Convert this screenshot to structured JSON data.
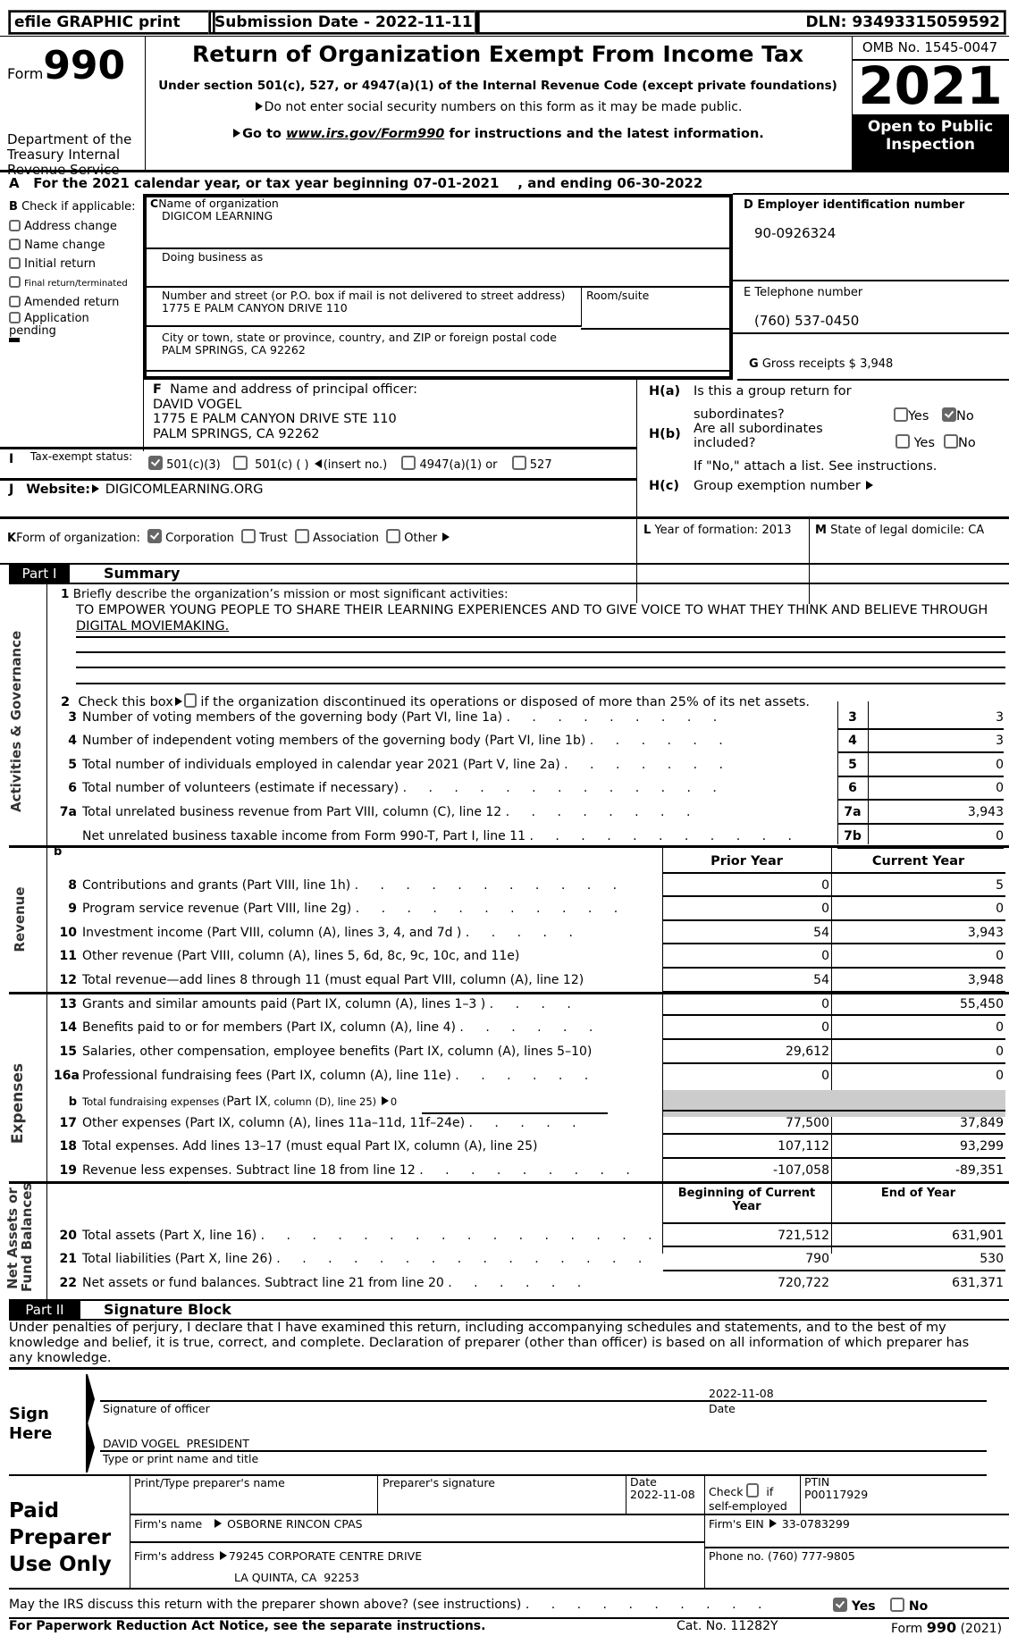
{
  "topbar": {
    "efile": "efile GRAPHIC print",
    "submission": "Submission Date - 2022-11-11",
    "dln": "DLN: 93493315059592"
  },
  "header": {
    "form_word": "Form",
    "form_number": "990",
    "dept": "Department of the Treasury Internal Revenue Service",
    "title": "Return of Organization Exempt From Income Tax",
    "subtitle": "Under section 501(c), 527, or 4947(a)(1) of the Internal Revenue Code (except private foundations)",
    "notice1": "Do not enter social security numbers on this form as it may be made public.",
    "notice2_pre": "Go to ",
    "notice2_link": "www.irs.gov/Form990",
    "notice2_post": " for instructions and the latest information.",
    "omb": "OMB No. 1545-0047",
    "year": "2021",
    "open_public": "Open to Public Inspection"
  },
  "lineA": "A   For the 2021 calendar year, or tax year beginning 07-01-2021    , and ending 06-30-2022",
  "sectionB": {
    "title": "Check if applicable:",
    "letter": "B",
    "items": [
      {
        "label": "Address change",
        "checked": false
      },
      {
        "label": "Name change",
        "checked": false
      },
      {
        "label": "Initial return",
        "checked": false
      },
      {
        "label": "Final return/terminated",
        "checked": false
      },
      {
        "label": "Amended return",
        "checked": false
      },
      {
        "label": "Application pending",
        "checked": false
      }
    ]
  },
  "sectionC": {
    "letter": "C",
    "name_label": "Name of organization",
    "name": "DIGICOM LEARNING",
    "dba_label": "Doing business as",
    "dba": "",
    "street_label": "Number and street (or P.O. box if mail is not delivered to street address)",
    "street": "1775 E PALM CANYON DRIVE 110",
    "room_label": "Room/suite",
    "room": "",
    "city_label": "City or town, state or province, country, and ZIP or foreign postal code",
    "city": "PALM SPRINGS, CA  92262"
  },
  "sectionD": {
    "label": "D Employer identification number",
    "value": "90-0926324"
  },
  "sectionE": {
    "label": "E Telephone number",
    "value": "(760) 537-0450"
  },
  "sectionG": {
    "letter": "G",
    "label": "Gross receipts $",
    "value": "3,948"
  },
  "sectionF": {
    "letter": "F",
    "label": "Name and address of principal officer:",
    "lines": [
      "DAVID VOGEL",
      "1775 E PALM CANYON DRIVE STE 110",
      "PALM SPRINGS, CA  92262"
    ]
  },
  "sectionH": {
    "ha_label": "H(a)",
    "ha_text1": "Is this a group return for",
    "ha_text2": "subordinates?",
    "ha_yes": false,
    "ha_no": true,
    "hb_label": "H(b)",
    "hb_text1": "Are all subordinates",
    "hb_text2": "included?",
    "hb_yes": false,
    "hb_no": false,
    "hb_note": "If \"No,\" attach a list. See instructions.",
    "hc_label": "H(c)",
    "hc_text": "Group exemption number",
    "yes": "Yes",
    "no": "No"
  },
  "sectionI": {
    "letter": "I",
    "label": "Tax-exempt status:",
    "options": [
      {
        "label": "501(c)(3)",
        "checked": true
      },
      {
        "label": "501(c) (   )",
        "checked": false,
        "suffix": "(insert no.)"
      },
      {
        "label": "4947(a)(1) or",
        "checked": false
      },
      {
        "label": "527",
        "checked": false
      }
    ]
  },
  "sectionJ": {
    "letter": "J",
    "label": "Website:",
    "value": "DIGICOMLEARNING.ORG"
  },
  "sectionK": {
    "letter": "K",
    "label": "Form of organization:",
    "options": [
      {
        "label": "Corporation",
        "checked": true
      },
      {
        "label": "Trust",
        "checked": false
      },
      {
        "label": "Association",
        "checked": false
      },
      {
        "label": "Other",
        "checked": false
      }
    ]
  },
  "sectionL": {
    "letter": "L",
    "label": "Year of formation: 2013"
  },
  "sectionM": {
    "letter": "M",
    "label": "State of legal domicile: CA"
  },
  "part1": {
    "part_label": "Part I",
    "title": "Summary",
    "side_labels": {
      "activities": "Activities & Governance",
      "revenue": "Revenue",
      "expenses": "Expenses",
      "net_assets_1": "Net Assets or",
      "net_assets_2": "Fund Balances"
    },
    "line1_num": "1",
    "line1_label": "Briefly describe the organization’s mission or most significant activities:",
    "mission_1": "TO EMPOWER YOUNG PEOPLE TO SHARE THEIR LEARNING EXPERIENCES AND TO GIVE VOICE TO WHAT THEY THINK AND BELIEVE THROUGH",
    "mission_2": "DIGITAL MOVIEMAKING.",
    "line2_num": "2",
    "line2_pre": "Check this box",
    "line2_post": "if the organization discontinued its operations or disposed of more than 25% of its net assets.",
    "gov_lines": [
      {
        "num": "3",
        "label": "Number of voting members of the governing body (Part VI, line 1a)",
        "dots": ". . . . . . . . .",
        "box": "3",
        "value": "3"
      },
      {
        "num": "4",
        "label": "Number of independent voting members of the governing body (Part VI, line 1b)",
        "dots": ". . . . . .",
        "box": "4",
        "value": "3"
      },
      {
        "num": "5",
        "label": "Total number of individuals employed in calendar year 2021 (Part V, line 2a)",
        "dots": ". . . . . . .",
        "box": "5",
        "value": "0"
      },
      {
        "num": "6",
        "label": "Total number of volunteers (estimate if necessary)",
        "dots": ". . . . . . . . . . . . .",
        "box": "6",
        "value": "0"
      },
      {
        "num": "7a",
        "label": "Total unrelated business revenue from Part VIII, column (C), line 12",
        "dots": ". . . . . . . .",
        "box": "7a",
        "value": "3,943"
      },
      {
        "num": "",
        "label": "Net unrelated business taxable income from Form 990-T, Part I, line 11",
        "dots": ". . . . . . . . . . .",
        "box": "7b",
        "value": "0"
      }
    ],
    "line7b_letter": "b",
    "col_prior": "Prior Year",
    "col_current": "Current Year",
    "revenue_lines": [
      {
        "num": "8",
        "label": "Contributions and grants (Part VIII, line 1h)",
        "dots": ". . . . . . . . . . .",
        "prior": "0",
        "current": "5"
      },
      {
        "num": "9",
        "label": "Program service revenue (Part VIII, line 2g)",
        "dots": ". . . . . . . . . . .",
        "prior": "0",
        "current": "0"
      },
      {
        "num": "10",
        "label": "Investment income (Part VIII, column (A), lines 3, 4, and 7d )",
        "dots": ". . . . .",
        "prior": "54",
        "current": "3,943"
      },
      {
        "num": "11",
        "label": "Other revenue (Part VIII, column (A), lines 5, 6d, 8c, 9c, 10c, and 11e)",
        "dots": "",
        "prior": "0",
        "current": "0"
      },
      {
        "num": "12",
        "label": "Total revenue—add lines 8 through 11 (must equal Part VIII, column (A), line 12)",
        "dots": "",
        "prior": "54",
        "current": "3,948"
      }
    ],
    "expense_lines": [
      {
        "num": "13",
        "label": "Grants and similar amounts paid (Part IX, column (A), lines 1–3 )",
        "dots": ". . . .",
        "prior": "0",
        "current": "55,450"
      },
      {
        "num": "14",
        "label": "Benefits paid to or for members (Part IX, column (A), line 4)",
        "dots": ". . . . . .",
        "prior": "0",
        "current": "0"
      },
      {
        "num": "15",
        "label": "Salaries, other compensation, employee benefits (Part IX, column (A), lines 5–10)",
        "dots": "",
        "prior": "29,612",
        "current": "0"
      },
      {
        "num": "16a",
        "label": "Professional fundraising fees (Part IX, column (A), line 11e)",
        "dots": ". . . . . .",
        "prior": "0",
        "current": "0"
      }
    ],
    "line16b_num": "b",
    "line16b_label_pre": "Total fundraising expenses (",
    "line16b_label_mid": "Part IX",
    "line16b_label_post": ", column (D), line 25)",
    "line16b_value": "0",
    "expense_lines_2": [
      {
        "num": "17",
        "label": "Other expenses (Part IX, column (A), lines 11a–11d, 11f–24e)",
        "dots": ". . . . .",
        "prior": "77,500",
        "current": "37,849"
      },
      {
        "num": "18",
        "label": "Total expenses. Add lines 13–17 (must equal Part IX, column (A), line 25)",
        "dots": "",
        "prior": "107,112",
        "current": "93,299"
      },
      {
        "num": "19",
        "label": "Revenue less expenses. Subtract line 18 from line 12",
        "dots": ". . . . . . . . .",
        "prior": "-107,058",
        "current": "-89,351"
      }
    ],
    "col_begin": "Beginning of Current Year",
    "col_end": "End of Year",
    "net_lines": [
      {
        "num": "20",
        "label": "Total assets (Part X, line 16)",
        "dots": ". . . . . . . . . . . . . . . .",
        "prior": "721,512",
        "current": "631,901"
      },
      {
        "num": "21",
        "label": "Total liabilities (Part X, line 26)",
        "dots": ". . . . . . . . . . . . . . .",
        "prior": "790",
        "current": "530"
      },
      {
        "num": "22",
        "label": "Net assets or fund balances. Subtract line 21 from line 20",
        "dots": ". . . . . .",
        "prior": "720,722",
        "current": "631,371"
      }
    ]
  },
  "part2": {
    "part_label": "Part II",
    "title": "Signature Block",
    "perjury": "Under penalties of perjury, I declare that I have examined this return, including accompanying schedules and statements, and to the best of my knowledge and belief, it is true, correct, and complete. Declaration of preparer (other than officer) is based on all information of which preparer has any knowledge.",
    "sign_here_1": "Sign",
    "sign_here_2": "Here",
    "sig_label": "Signature of officer",
    "sig_date": "2022-11-08",
    "date_label": "Date",
    "officer_name": "DAVID VOGEL  PRESIDENT",
    "officer_name_label": "Type or print name and title"
  },
  "preparer": {
    "heading_1": "Paid",
    "heading_2": "Preparer",
    "heading_3": "Use Only",
    "name_label": "Print/Type preparer's name",
    "name": "",
    "sig_label": "Preparer's signature",
    "date_label": "Date",
    "date": "2022-11-08",
    "check_label": "Check",
    "check_if": "if",
    "self_employed": "self-employed",
    "self_employed_checked": false,
    "ptin_label": "PTIN",
    "ptin": "P00117929",
    "firm_name_label": "Firm's name",
    "firm_name": "OSBORNE RINCON CPAS",
    "firm_ein_label": "Firm's EIN",
    "firm_ein": "33-0783299",
    "firm_address_label": "Firm's address",
    "firm_address_1": "79245 CORPORATE CENTRE DRIVE",
    "firm_address_2": "LA QUINTA, CA  92253",
    "phone_label": "Phone no.",
    "phone": "(760) 777-9805"
  },
  "footer": {
    "discuss": "May the IRS discuss this return with the preparer shown above? (see instructions)",
    "discuss_dots": ". . . . . . . . . .",
    "discuss_yes": true,
    "discuss_no": false,
    "yes": "Yes",
    "no": "No",
    "paperwork": "For Paperwork Reduction Act Notice, see the separate instructions.",
    "cat": "Cat. No. 11282Y",
    "form_pre": "Form ",
    "form_num": "990",
    "form_post": " (2021)"
  }
}
